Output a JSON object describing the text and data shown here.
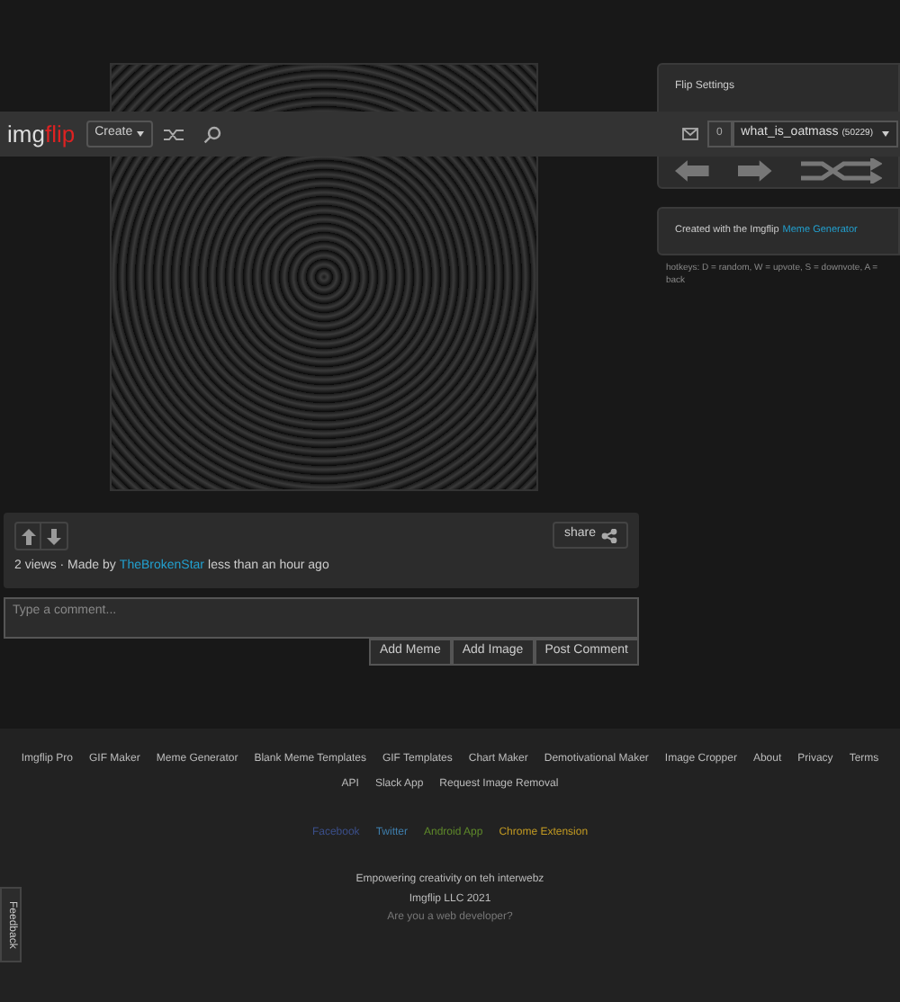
{
  "header": {
    "logo": {
      "text_1": "img",
      "text_2": "flip"
    },
    "create_menu": "Create",
    "notification_count": "0",
    "user": {
      "name": "what_is_oatmass",
      "points": "(50229)"
    }
  },
  "meme": {
    "vote": {
      "upvoted": false,
      "downvoted": false
    },
    "share": "share",
    "stats": {
      "views": "2 views · Made by",
      "author": "TheBrokenStar",
      "time": "less than an hour ago"
    }
  },
  "comment": {
    "placeholder": "Type a comment...",
    "buttons": [
      "Add Meme",
      "Add Image",
      "Post Comment"
    ]
  },
  "sidebar": {
    "flip_settings": {
      "title": "Flip Settings"
    },
    "credit": {
      "text": "Created with the Imgflip",
      "link": "Meme Generator"
    },
    "hotkeys": "hotkeys: D = random, W = upvote, S = downvote, A = back"
  },
  "footer": {
    "links": [
      "Imgflip Pro",
      "GIF Maker",
      "Meme Generator",
      "Blank Meme Templates",
      "GIF Templates",
      "Chart Maker",
      "Demotivational Maker",
      "Image Cropper",
      "About",
      "Privacy",
      "Terms",
      "API",
      "Slack App",
      "Request Image Removal"
    ],
    "social": [
      {
        "label": "Facebook",
        "color": "#3b4f8a"
      },
      {
        "label": "Twitter",
        "color": "#3f7fae"
      },
      {
        "label": "Android App",
        "color": "#5f8a2a"
      },
      {
        "label": "Chrome Extension",
        "color": "#c29a22"
      }
    ],
    "tagline": "Empowering creativity on teh interwebz",
    "copyright": "Imgflip LLC 2021",
    "developer_link": "Are you a web developer?"
  },
  "feedback_tab": "Feedback"
}
